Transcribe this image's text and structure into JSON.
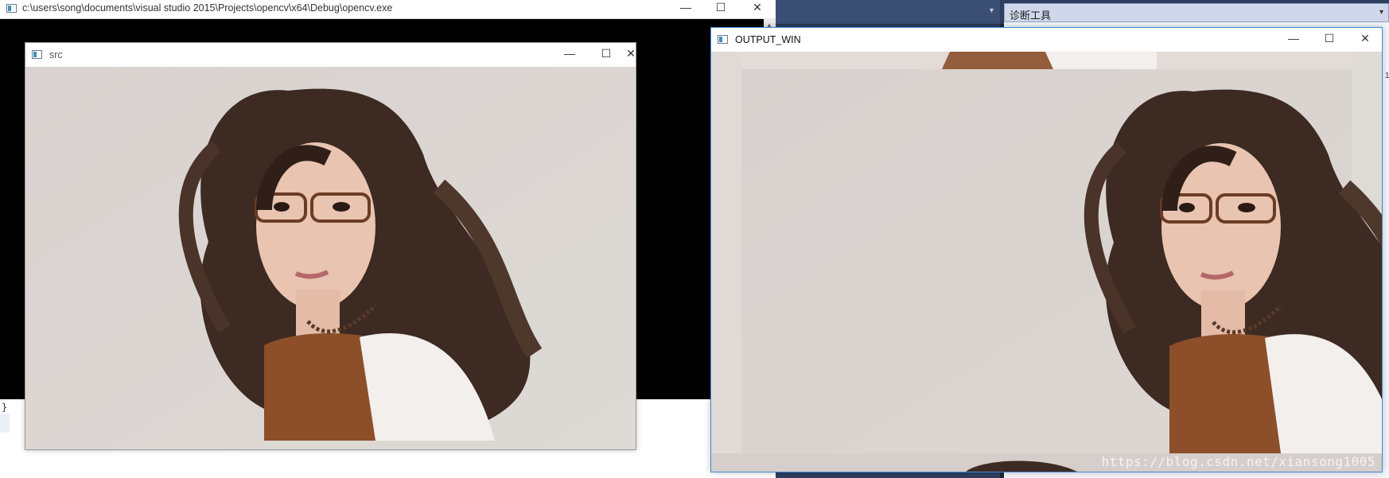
{
  "console": {
    "title": "c:\\users\\song\\documents\\visual studio 2015\\Projects\\opencv\\x64\\Debug\\opencv.exe",
    "minimize_glyph": "—",
    "maximize_glyph": "☐",
    "close_glyph": "✕"
  },
  "ide": {
    "panel_title": "诊断工具",
    "dropdown_glyph": "▾",
    "editor_fragment": "}"
  },
  "src_window": {
    "title": "src",
    "minimize_glyph": "—",
    "maximize_glyph": "☐",
    "close_glyph": "✕",
    "image_icon": "photo-portrait"
  },
  "output_window": {
    "title": "OUTPUT_WIN",
    "minimize_glyph": "—",
    "maximize_glyph": "☐",
    "close_glyph": "✕",
    "image_icon": "photo-portrait",
    "watermark": "https://blog.csdn.net/xiansong1005"
  },
  "colors": {
    "ide_dark": "#2d3e5e",
    "active_border": "#3f8ad8",
    "photo_background": "#dcd6d4"
  }
}
